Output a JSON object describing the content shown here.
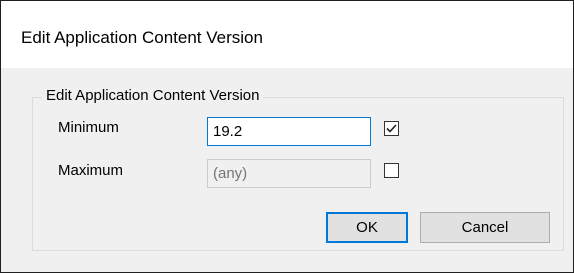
{
  "window": {
    "title": "Edit Application Content Version"
  },
  "group": {
    "label": "Edit Application Content Version"
  },
  "minimum": {
    "label": "Minimum",
    "value": "19.2",
    "checked": true
  },
  "maximum": {
    "label": "Maximum",
    "placeholder": "(any)",
    "checked": false
  },
  "buttons": {
    "ok": "OK",
    "cancel": "Cancel"
  },
  "colors": {
    "accent": "#0078d7",
    "dialog_bg": "#f0f0f0",
    "titlebar_bg": "#ffffff"
  }
}
